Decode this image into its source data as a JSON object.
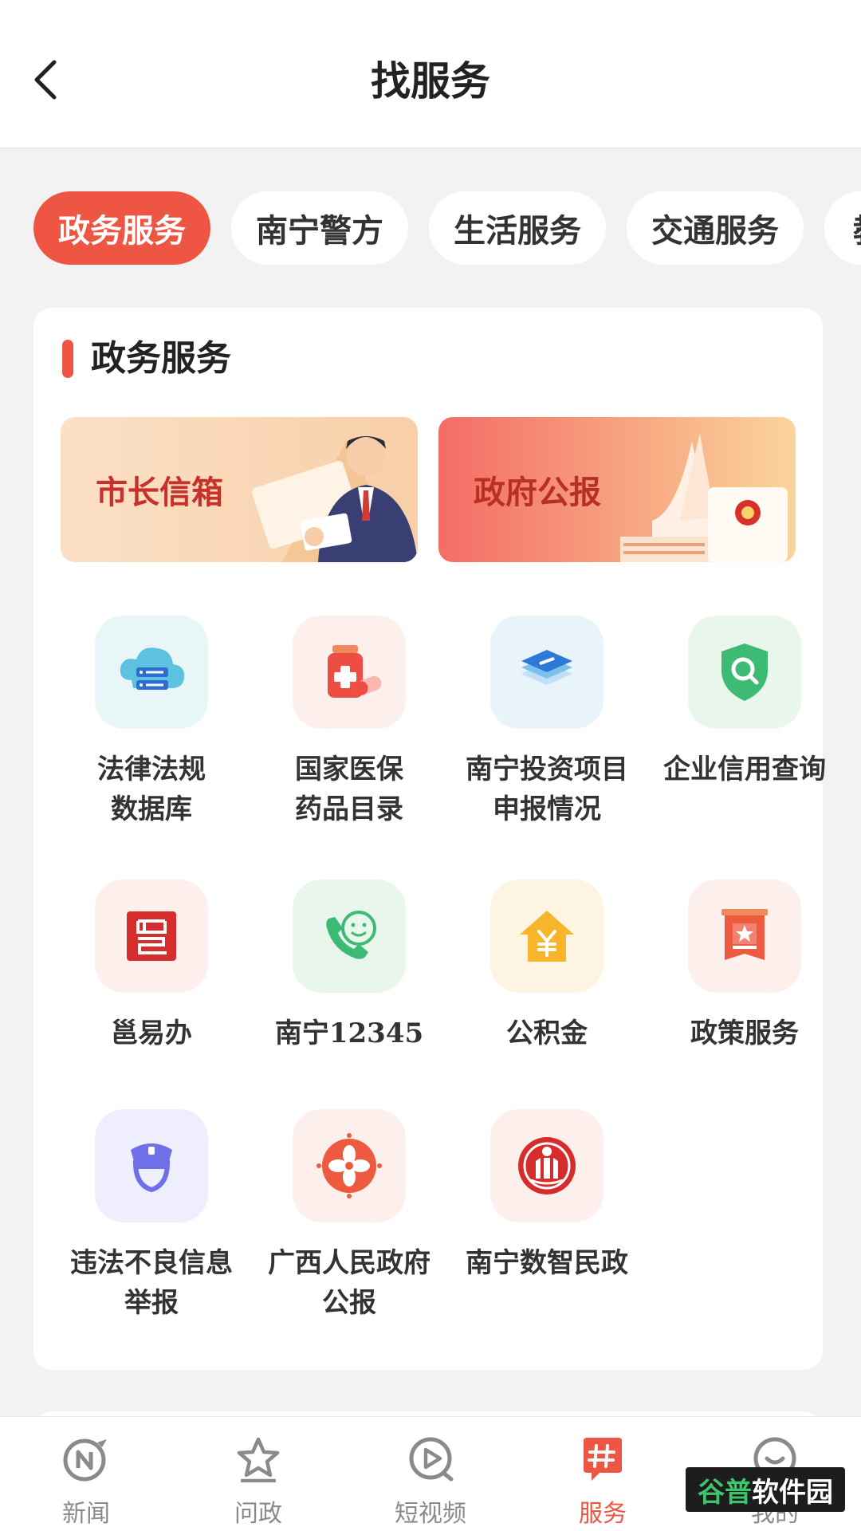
{
  "header": {
    "title": "找服务",
    "back_icon": "chevron-left-icon"
  },
  "tabs": [
    {
      "label": "政务服务",
      "active": true
    },
    {
      "label": "南宁警方",
      "active": false
    },
    {
      "label": "生活服务",
      "active": false
    },
    {
      "label": "交通服务",
      "active": false
    },
    {
      "label": "教",
      "active": false
    }
  ],
  "section": {
    "title": "政务服务",
    "accent": "#ef5543",
    "banners": [
      {
        "label": "市长信箱"
      },
      {
        "label": "政府公报"
      }
    ],
    "services": [
      {
        "label_line1": "法律法规",
        "label_line2": "数据库",
        "icon": "cloud-server-icon"
      },
      {
        "label_line1": "国家医保",
        "label_line2": "药品目录",
        "icon": "medicine-bottle-icon"
      },
      {
        "label_line1": "南宁投资项目",
        "label_line2": "申报情况",
        "icon": "layers-icon"
      },
      {
        "label_line1": "企业信用查询",
        "label_line2": "",
        "icon": "shield-search-icon"
      },
      {
        "label_line1": "邕易办",
        "label_line2": "",
        "icon": "yong-seal-icon"
      },
      {
        "label_line1": "南宁12345",
        "label_line2": "",
        "icon": "phone-smile-icon"
      },
      {
        "label_line1": "公积金",
        "label_line2": "",
        "icon": "house-yuan-icon"
      },
      {
        "label_line1": "政策服务",
        "label_line2": "",
        "icon": "policy-document-icon"
      },
      {
        "label_line1": "违法不良信息",
        "label_line2": "举报",
        "icon": "police-officer-icon"
      },
      {
        "label_line1": "广西人民政府",
        "label_line2": "公报",
        "icon": "flower-emblem-icon"
      },
      {
        "label_line1": "南宁数智民政",
        "label_line2": "",
        "icon": "civil-affairs-emblem-icon"
      }
    ]
  },
  "bottom_nav": [
    {
      "label": "新闻",
      "icon": "news-icon",
      "active": false
    },
    {
      "label": "问政",
      "icon": "star-icon",
      "active": false
    },
    {
      "label": "短视频",
      "icon": "video-play-icon",
      "active": false
    },
    {
      "label": "服务",
      "icon": "hash-service-icon",
      "active": true
    },
    {
      "label": "我的",
      "icon": "profile-icon",
      "active": false
    }
  ],
  "watermark": {
    "part1": "谷普",
    "part2": "软件园"
  }
}
